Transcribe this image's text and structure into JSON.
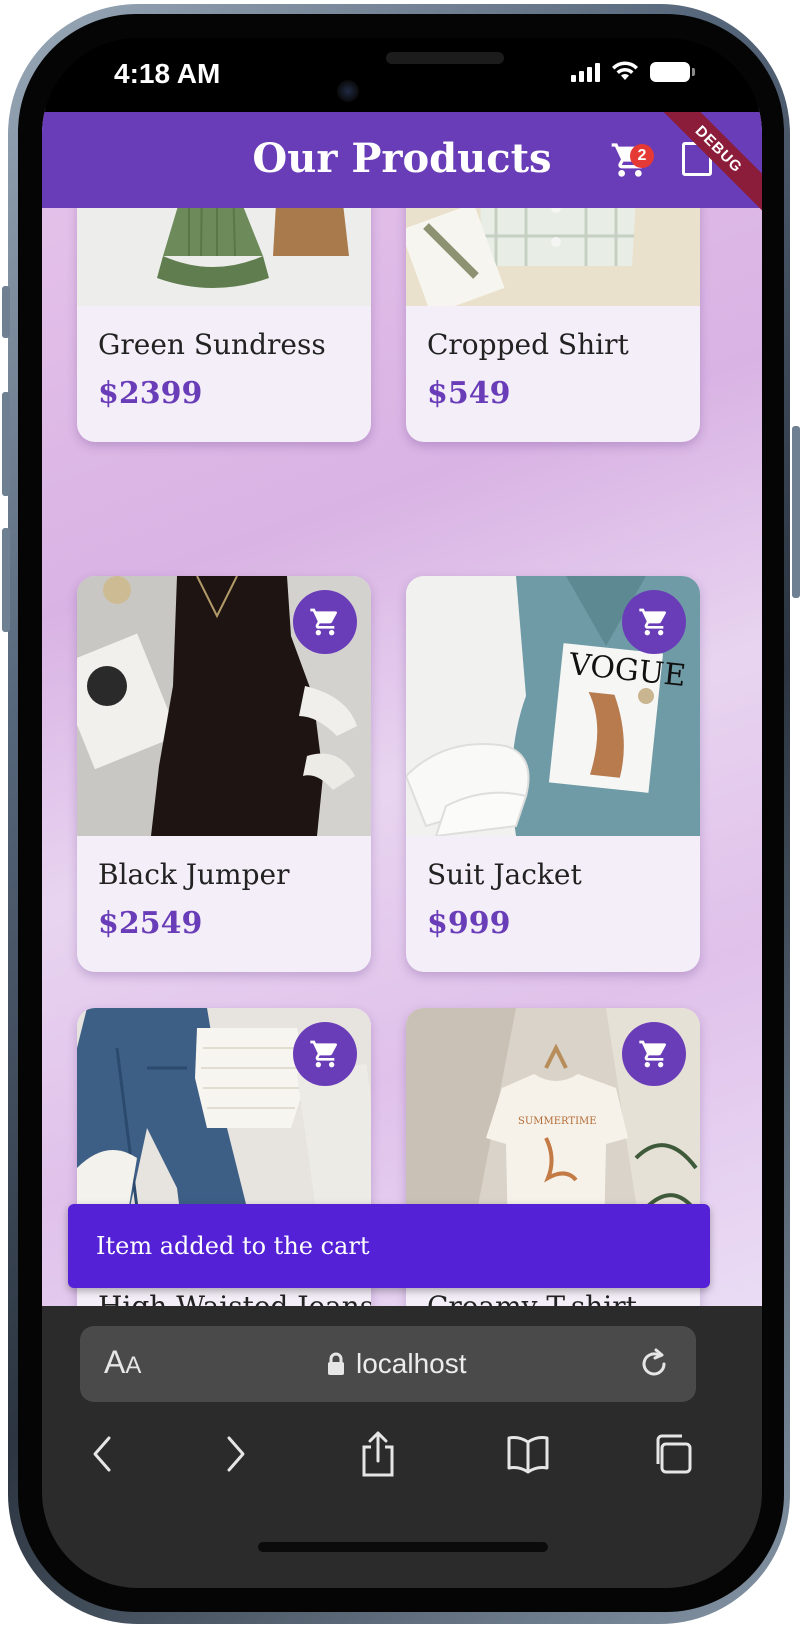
{
  "status_bar": {
    "time": "4:18 AM"
  },
  "app_bar": {
    "title": "Our Products",
    "cart_count": "2",
    "debug_label": "DEBUG"
  },
  "products": [
    {
      "name": "Green Sundress",
      "price": "$2399"
    },
    {
      "name": "Cropped Shirt",
      "price": "$549"
    },
    {
      "name": "Black Jumper",
      "price": "$2549"
    },
    {
      "name": "Suit Jacket",
      "price": "$999"
    },
    {
      "name": "High Waisted Jeans",
      "price": ""
    },
    {
      "name": "Creamy T-shirt",
      "price": ""
    }
  ],
  "snackbar": {
    "message": "Item added to the cart"
  },
  "browser": {
    "reader_big": "A",
    "reader_small": "A",
    "url": "localhost"
  },
  "colors": {
    "primary": "#6a3db8",
    "snackbar": "#5421d6",
    "badge": "#e53935",
    "debug": "#8b1c3a"
  },
  "icons": [
    "cart-icon",
    "add-to-cart-icon",
    "lock-icon",
    "reload-icon",
    "back-icon",
    "forward-icon",
    "share-icon",
    "bookmarks-icon",
    "tabs-icon"
  ]
}
